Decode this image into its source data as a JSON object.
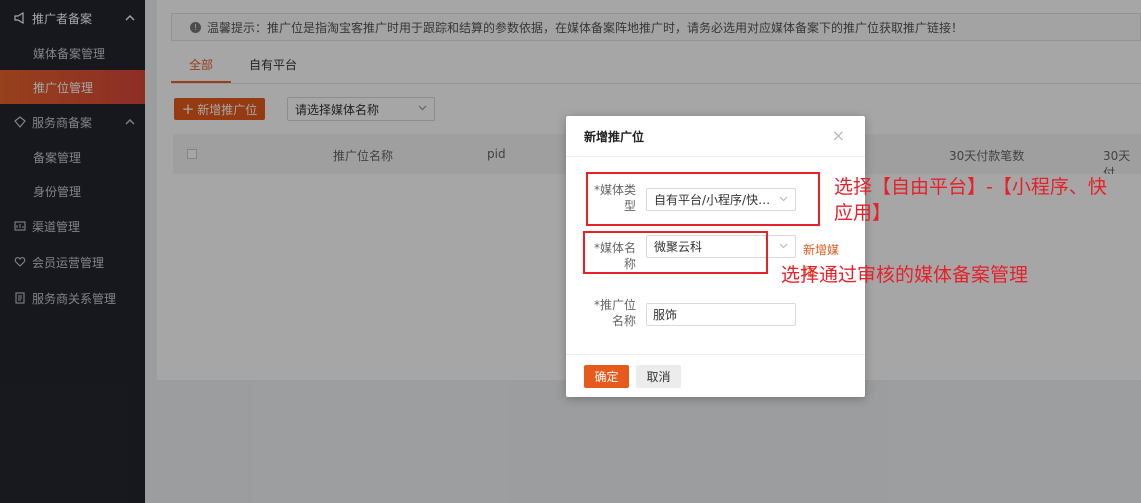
{
  "sidebar": {
    "groups": [
      {
        "label": "推广者备案",
        "icon": "megaphone-icon",
        "items": [
          "媒体备案管理",
          "推广位管理"
        ]
      },
      {
        "label": "服务商备案",
        "icon": "diamond-icon",
        "items": [
          "备案管理",
          "身份管理"
        ]
      },
      {
        "label": "渠道管理",
        "icon": "channel-icon"
      },
      {
        "label": "会员运营管理",
        "icon": "heart-icon"
      },
      {
        "label": "服务商关系管理",
        "icon": "document-icon"
      }
    ],
    "active_item": "推广位管理"
  },
  "tip": {
    "text": "温馨提示：推广位是指淘宝客推广时用于跟踪和结算的参数依据，在媒体备案阵地推广时，请务必选用对应媒体备案下的推广位获取推广链接！"
  },
  "tabs": [
    {
      "label": "全部",
      "active": true
    },
    {
      "label": "自有平台",
      "active": false
    }
  ],
  "toolbar": {
    "add_label": "新增推广位",
    "media_select_placeholder": "请选择媒体名称"
  },
  "table": {
    "columns": [
      "推广位名称",
      "pid",
      "30天付款笔数",
      "30天付"
    ]
  },
  "modal": {
    "title": "新增推广位",
    "media_type_label": "*媒体类型",
    "media_type_value": "自有平台/小程序/快…",
    "media_name_label": "*媒体名称",
    "media_name_value": "微聚云科",
    "new_media_link": "新增媒体",
    "position_name_label": "*推广位名称",
    "position_name_value": "服饰",
    "ok_label": "确定",
    "cancel_label": "取消"
  },
  "annotations": {
    "note1": "选择【自由平台】-【小程序、快应用】",
    "note2": "选择通过审核的媒体备案管理"
  },
  "colors": {
    "accent": "#e65a1c",
    "annotation": "#e8202a",
    "sidebar_bg": "#23262e"
  }
}
